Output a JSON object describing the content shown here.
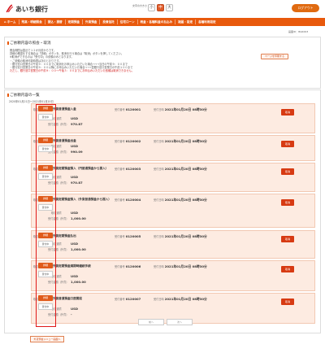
{
  "header": {
    "bank_name": "あいち銀行",
    "font_size_label": "文字の大きさ",
    "font_sizes": [
      "小",
      "中",
      "大"
    ],
    "logout_label": "ログアウト"
  },
  "nav": {
    "items": [
      "ホーム",
      "残高・明細照会",
      "振込・振替",
      "定期預金",
      "外貨預金",
      "投資信託",
      "住宅ローン",
      "税金・各種料金の払込み",
      "諸届・設定",
      "各種利用設定"
    ]
  },
  "screen_id": "画面ID：BGR003",
  "main": {
    "title": "ご依頼内容の照会・取消",
    "info": [
      "照会期間は直近で１２か月前からです。",
      "詳細の確認をする場合は「詳細」ボタンを、取消を行う場合は「取消」ボタンを押してください。",
      "※取消ができるのは「受付中」の依頼のみとなります。",
      "・ご依頼の取消可能時間は次のとおりです。",
      "・銀行窓口営業日の午前９：００までに取消をお申込みいただいた場合→→→当日の午前９：００まで",
      "・銀行窓口営業日の午前９：００以降にお申込みいただいた場合→→→翌銀行窓口営業日の午前１００まで",
      "ただし、銀行窓口営業日の午前９：００～午後３：００までにお申込みいただいた依頼は取消できません。"
    ],
    "print_label": "ページを印刷する"
  },
  "list": {
    "title": "ご依頼内容の一覧",
    "period": "2020年01月21日～2021年01月20日",
    "labels": {
      "type": "取引内容",
      "receipt_no": "受付番号",
      "receipt_date": "受付日時",
      "currency": "取引通貨",
      "amount": "受付金額（外貨）"
    },
    "detail_label": "詳細",
    "cancel_label": "取消",
    "items": [
      {
        "type": "外貨普通預金入金",
        "receipt_no": "0120001",
        "date": "2021年01月20日 08時30分",
        "currency": "USD",
        "amount": "970.87",
        "status": "受付中"
      },
      {
        "type": "外貨普通預金出金",
        "receipt_no": "0120002",
        "date": "2021年01月20日 08時30分",
        "currency": "USD",
        "amount": "990.09",
        "status": "受付中"
      },
      {
        "type": "外貨定期預金預入（円普通預金から振入）",
        "receipt_no": "0120003",
        "date": "2021年01月20日 08時30分",
        "currency": "USD",
        "amount": "970.87",
        "status": "受付中"
      },
      {
        "type": "外貨定期預金預入（外貨普通預金から振入）",
        "receipt_no": "0120004",
        "date": "2021年01月20日 08時30分",
        "currency": "USD",
        "amount": "1,000.00",
        "status": "受付中"
      },
      {
        "type": "外貨定期預金払出",
        "receipt_no": "0120005",
        "date": "2021年01月20日 08時30分",
        "currency": "USD",
        "amount": "1,000.00",
        "status": "受付中"
      },
      {
        "type": "外貨定期預金満期時継続手続",
        "receipt_no": "0120006",
        "date": "2021年01月20日 08時30分",
        "currency": "USD",
        "amount": "1,000.00",
        "status": "受付中"
      },
      {
        "type": "外貨普通預金口座開設",
        "receipt_no": "0120007",
        "date": "2021年01月20日 08時30分",
        "currency": "USD",
        "amount": "-",
        "status": "受付中"
      }
    ],
    "prev_label": "前へ",
    "next_label": "次へ"
  },
  "footer": {
    "back_label": "外貨預金メニュー画面へ"
  },
  "colors": {
    "brand": "#e8590c",
    "row_bg": "#fdebe1",
    "cancel": "#d73a12",
    "highlight": "#e01a1a"
  }
}
